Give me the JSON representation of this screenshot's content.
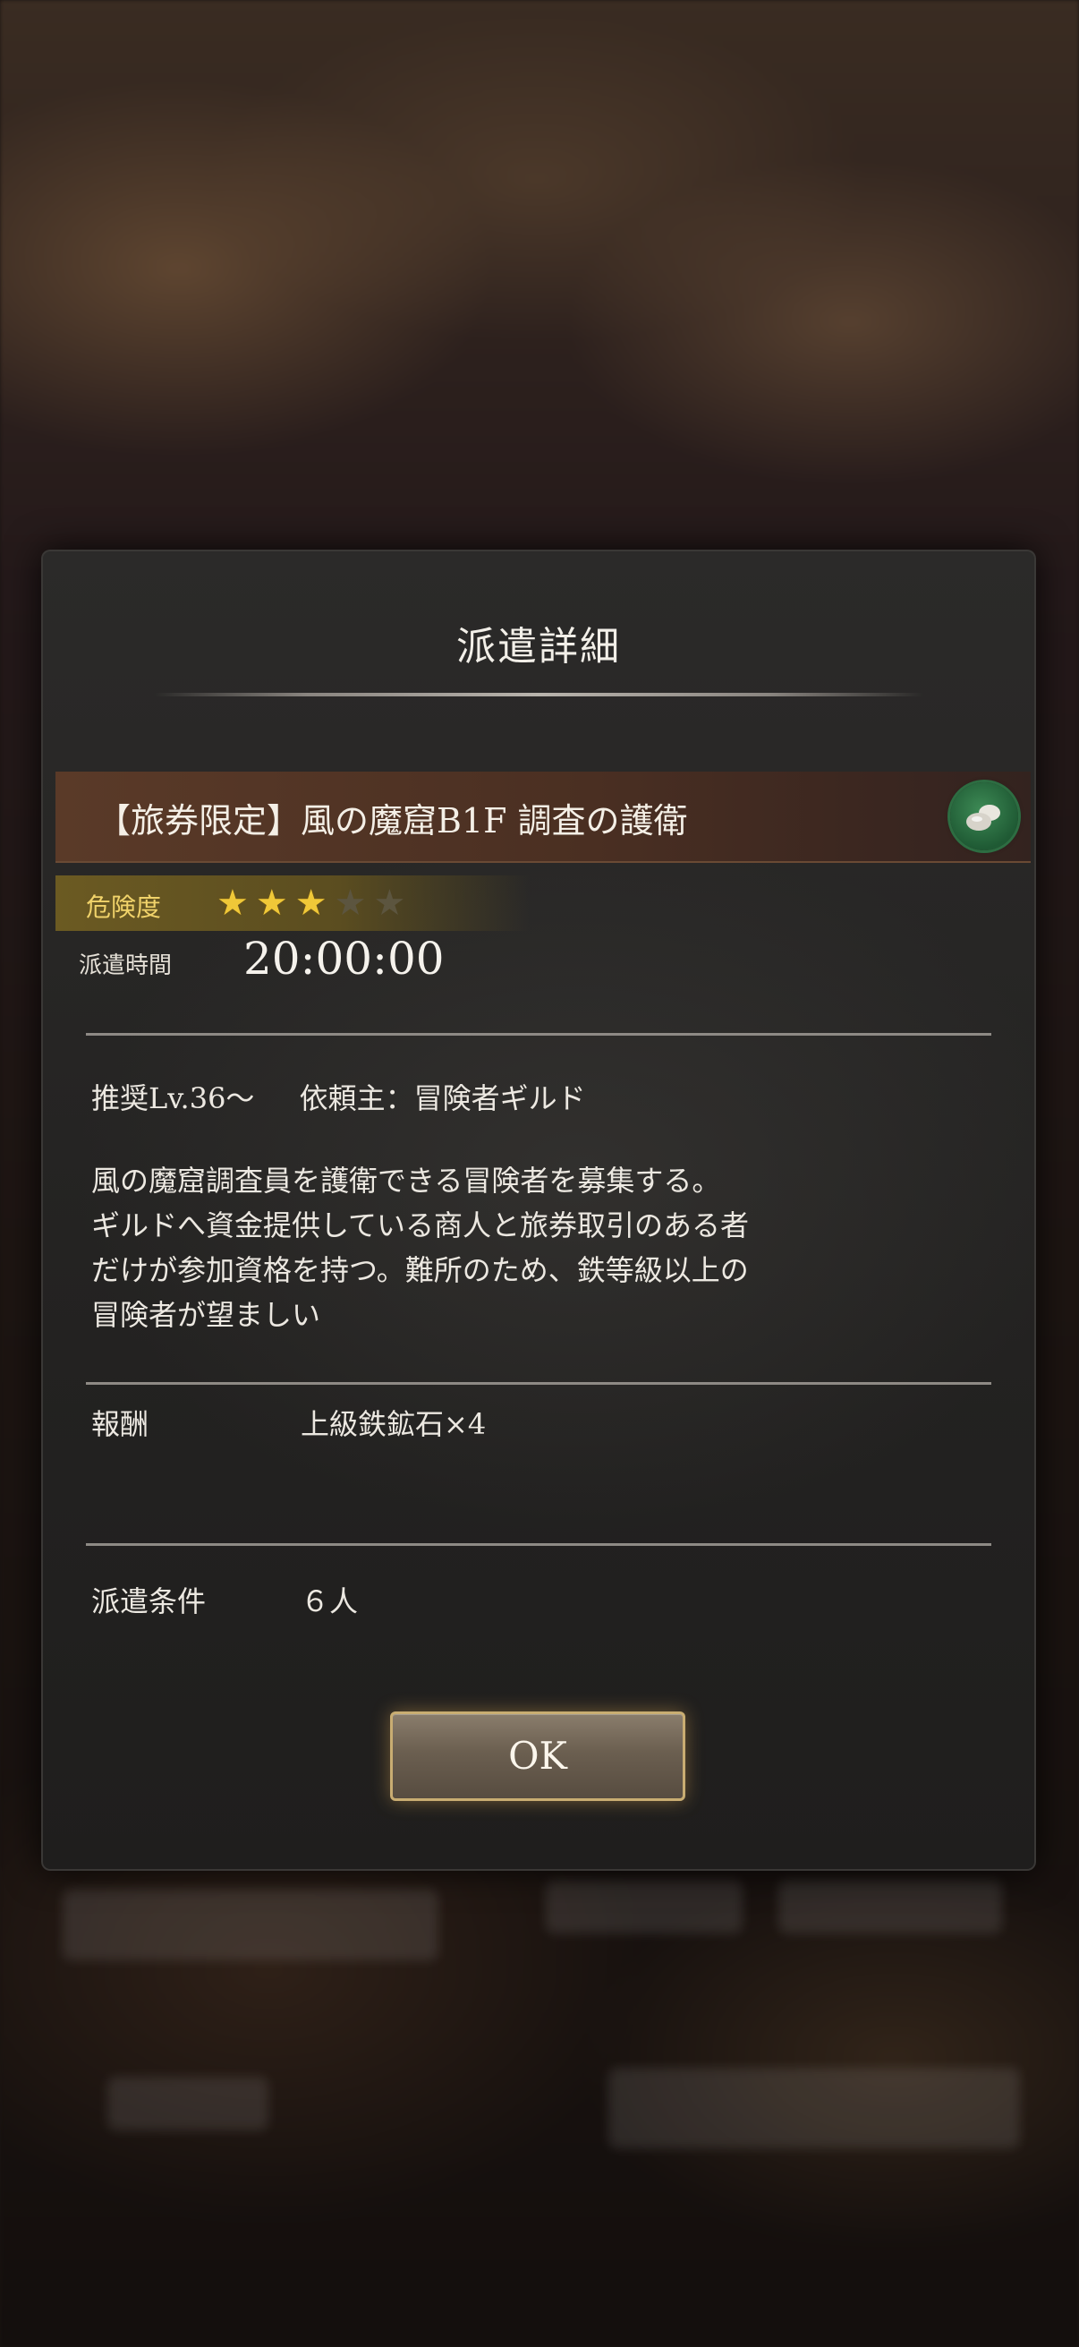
{
  "background": {
    "title": "",
    "subtitle": ""
  },
  "dialog": {
    "title": "派遣詳細",
    "mission": {
      "name": "【旅券限定】風の魔窟B1F 調査の護衛",
      "icon": "ore-icon"
    },
    "danger": {
      "label": "危険度",
      "rating": 3,
      "max": 5
    },
    "time": {
      "label": "派遣時間",
      "value": "20:00:00"
    },
    "recommended_level": "推奨Lv.36～",
    "client": "依頼主：冒険者ギルド",
    "description": [
      "風の魔窟調査員を護衛できる冒険者を募集する。",
      "ギルドへ資金提供している商人と旅券取引のある者",
      "だけが参加資格を持つ。難所のため、鉄等級以上の",
      "冒険者が望ましい"
    ],
    "reward": {
      "label": "報酬",
      "value": "上級鉄鉱石×4"
    },
    "condition": {
      "label": "派遣条件",
      "value": "６人"
    },
    "ok_label": "OK"
  },
  "colors": {
    "star_on": "#f0c838",
    "star_off": "#5c553f",
    "danger_label": "#f1d36a",
    "button_border": "#c9ad72"
  }
}
